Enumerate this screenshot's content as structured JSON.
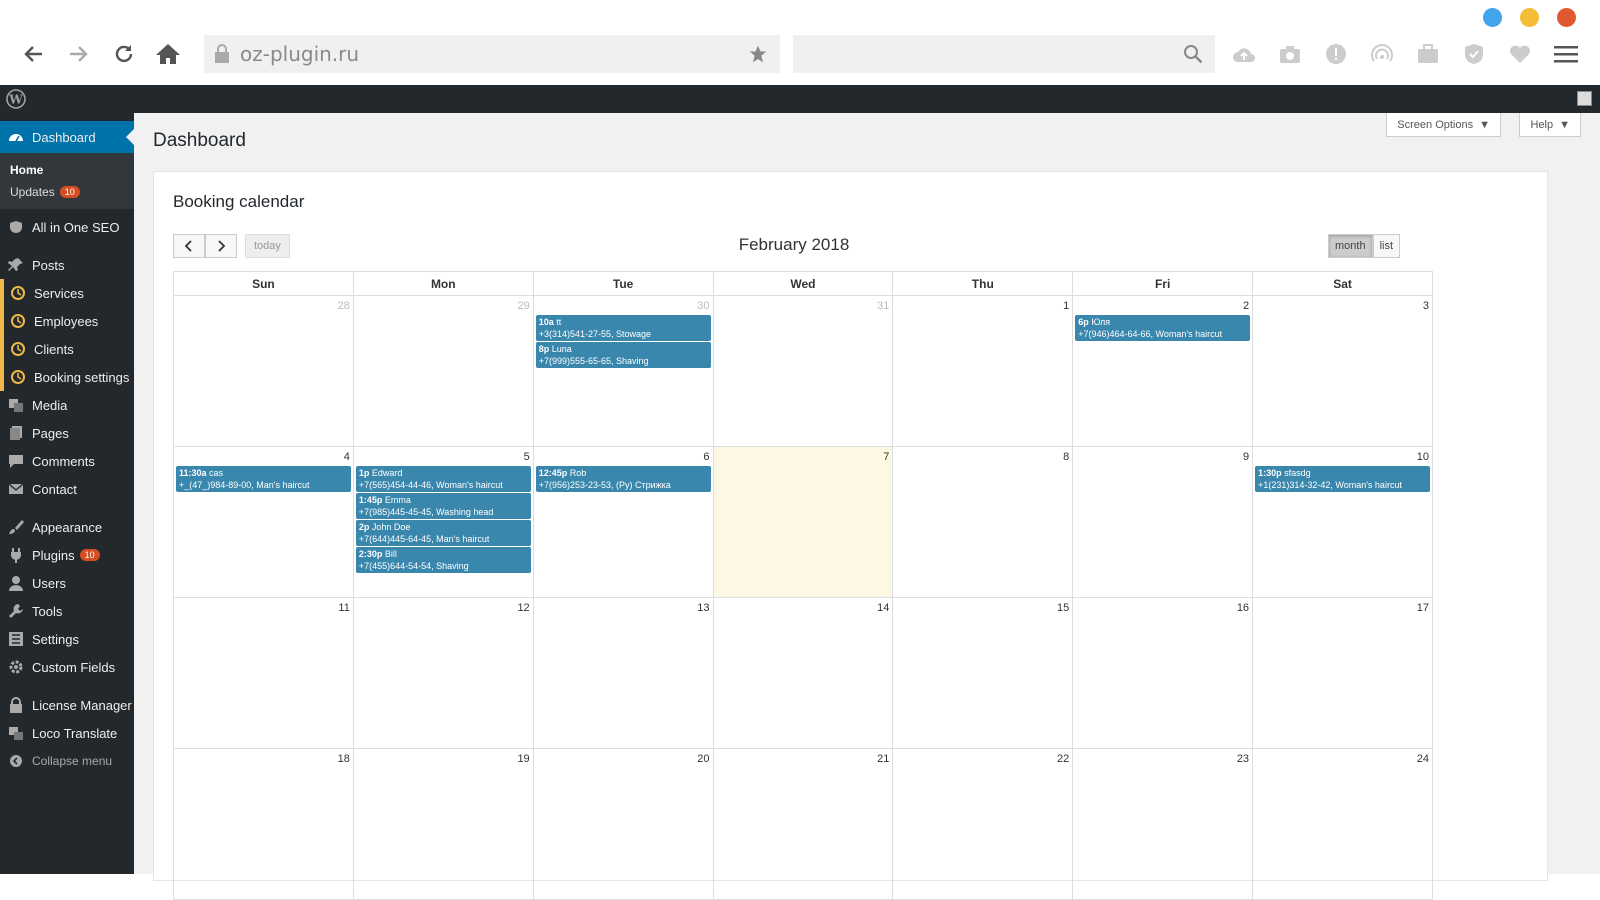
{
  "browser": {
    "url": "oz-plugin.ru",
    "search_placeholder": "",
    "dots": [
      "#41a5ee",
      "#f5bd36",
      "#e0582f"
    ]
  },
  "sidebar": {
    "dashboard": "Dashboard",
    "sub_home": "Home",
    "sub_updates": "Updates",
    "updates_count": "10",
    "seo": "All in One SEO",
    "posts": "Posts",
    "services": "Services",
    "employees": "Employees",
    "clients": "Clients",
    "booking_settings": "Booking settings",
    "media": "Media",
    "pages": "Pages",
    "comments": "Comments",
    "contact": "Contact",
    "appearance": "Appearance",
    "plugins": "Plugins",
    "plugins_count": "10",
    "users": "Users",
    "tools": "Tools",
    "settings": "Settings",
    "custom_fields": "Custom Fields",
    "license_manager": "License Manager",
    "loco_translate": "Loco Translate",
    "collapse": "Collapse menu"
  },
  "header": {
    "title": "Dashboard",
    "screen_options": "Screen Options",
    "help": "Help"
  },
  "calendar": {
    "panel_title": "Booking calendar",
    "today_label": "today",
    "month_title": "February 2018",
    "view_month": "month",
    "view_list": "list",
    "weekdays": [
      "Sun",
      "Mon",
      "Tue",
      "Wed",
      "Thu",
      "Fri",
      "Sat"
    ],
    "weeks": [
      [
        {
          "d": "28",
          "other": true,
          "events": []
        },
        {
          "d": "29",
          "other": true,
          "events": []
        },
        {
          "d": "30",
          "other": true,
          "events": [
            {
              "time": "10a",
              "name": "tt",
              "info": "+3(314)541-27-55, Stowage"
            },
            {
              "time": "8p",
              "name": "Luna",
              "info": "+7(999)555-65-65, Shaving"
            }
          ]
        },
        {
          "d": "31",
          "other": true,
          "events": []
        },
        {
          "d": "1",
          "events": []
        },
        {
          "d": "2",
          "events": [
            {
              "time": "6p",
              "name": "Юля",
              "info": "+7(946)464-64-66, Woman's haircut"
            }
          ]
        },
        {
          "d": "3",
          "events": []
        }
      ],
      [
        {
          "d": "4",
          "events": [
            {
              "time": "11:30a",
              "name": "cas",
              "info": "+_(47_)984-89-00, Man's haircut"
            }
          ]
        },
        {
          "d": "5",
          "events": [
            {
              "time": "1p",
              "name": "Edward",
              "info": "+7(565)454-44-46, Woman's haircut"
            },
            {
              "time": "1:45p",
              "name": "Emma",
              "info": "+7(985)445-45-45, Washing head"
            },
            {
              "time": "2p",
              "name": "John Doe",
              "info": "+7(644)445-64-45, Man's haircut"
            },
            {
              "time": "2:30p",
              "name": "Bill",
              "info": "+7(455)644-54-54, Shaving"
            }
          ]
        },
        {
          "d": "6",
          "events": [
            {
              "time": "12:45p",
              "name": "Rob",
              "info": "+7(956)253-23-53, (Ру) Стрижка"
            }
          ]
        },
        {
          "d": "7",
          "today": true,
          "events": []
        },
        {
          "d": "8",
          "events": []
        },
        {
          "d": "9",
          "events": []
        },
        {
          "d": "10",
          "events": [
            {
              "time": "1:30p",
              "name": "sfasdg",
              "info": "+1(231)314-32-42, Woman's haircut"
            }
          ]
        }
      ],
      [
        {
          "d": "11",
          "events": []
        },
        {
          "d": "12",
          "events": []
        },
        {
          "d": "13",
          "events": []
        },
        {
          "d": "14",
          "events": []
        },
        {
          "d": "15",
          "events": []
        },
        {
          "d": "16",
          "events": []
        },
        {
          "d": "17",
          "events": []
        }
      ],
      [
        {
          "d": "18",
          "events": []
        },
        {
          "d": "19",
          "events": []
        },
        {
          "d": "20",
          "events": []
        },
        {
          "d": "21",
          "events": []
        },
        {
          "d": "22",
          "events": []
        },
        {
          "d": "23",
          "events": []
        },
        {
          "d": "24",
          "events": []
        }
      ]
    ]
  }
}
